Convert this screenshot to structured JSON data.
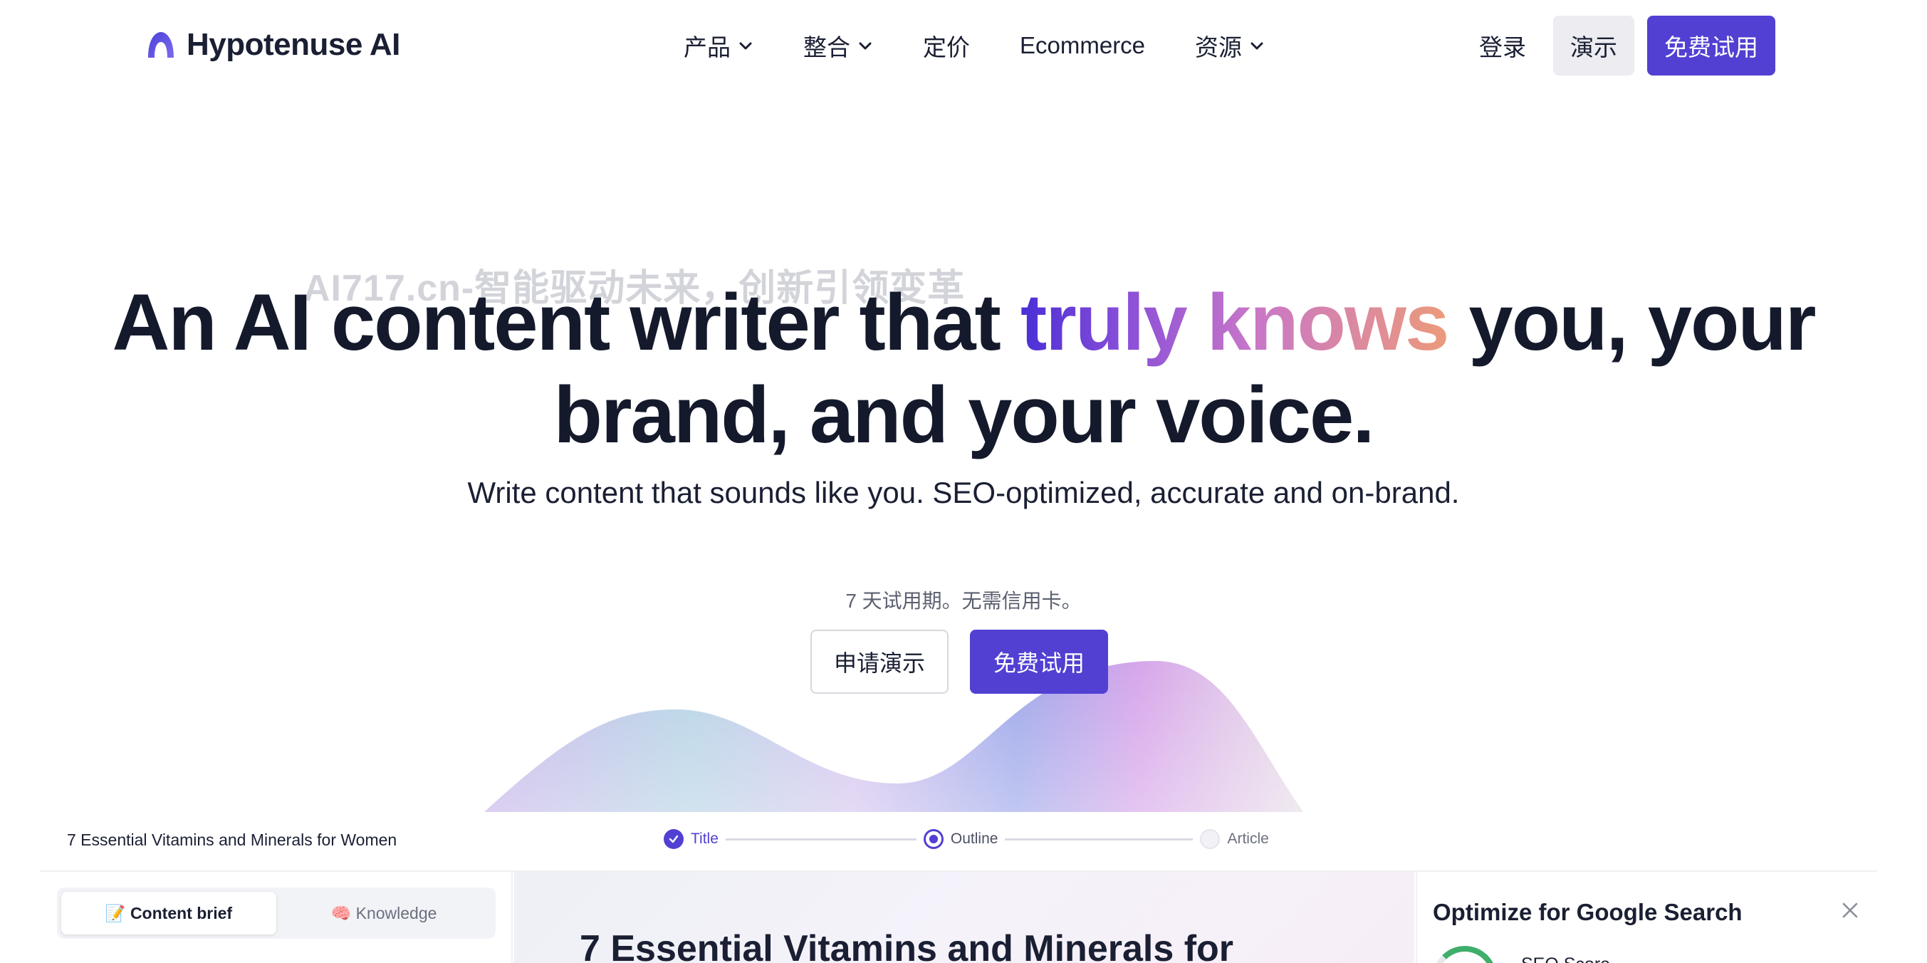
{
  "nav": {
    "logo_text": "Hypotenuse AI",
    "items": [
      {
        "label": "产品",
        "has_dropdown": true
      },
      {
        "label": "整合",
        "has_dropdown": true
      },
      {
        "label": "定价",
        "has_dropdown": false
      },
      {
        "label": "Ecommerce",
        "has_dropdown": false
      },
      {
        "label": "资源",
        "has_dropdown": true
      }
    ],
    "login": "登录",
    "demo": "演示",
    "trial": "免费试用"
  },
  "watermark": "AI717.cn-智能驱动未来，创新引领变革",
  "hero": {
    "title_part1": "An AI content writer that ",
    "title_highlight": "truly knows",
    "title_part2": " you, your",
    "title_line2": "brand, and your voice.",
    "subtitle": "Write content that sounds like you. SEO-optimized, accurate and on-brand.",
    "trial_note": "7 天试用期。无需信用卡。",
    "cta_demo": "申请演示",
    "cta_trial": "免费试用"
  },
  "app": {
    "doc_name": "7 Essential Vitamins and Minerals for Women",
    "steps": [
      {
        "label": "Title",
        "state": "done"
      },
      {
        "label": "Outline",
        "state": "current"
      },
      {
        "label": "Article",
        "state": "todo"
      }
    ],
    "tabs": [
      {
        "label": "📝 Content brief",
        "active": true
      },
      {
        "label": "🧠 Knowledge",
        "active": false
      }
    ],
    "editor_title": "7 Essential Vitamins and Minerals for",
    "side_panel": {
      "title": "Optimize for Google Search",
      "seo_label": "SEO Score"
    }
  },
  "colors": {
    "brand": "#5140d2",
    "text": "#141a2c"
  }
}
